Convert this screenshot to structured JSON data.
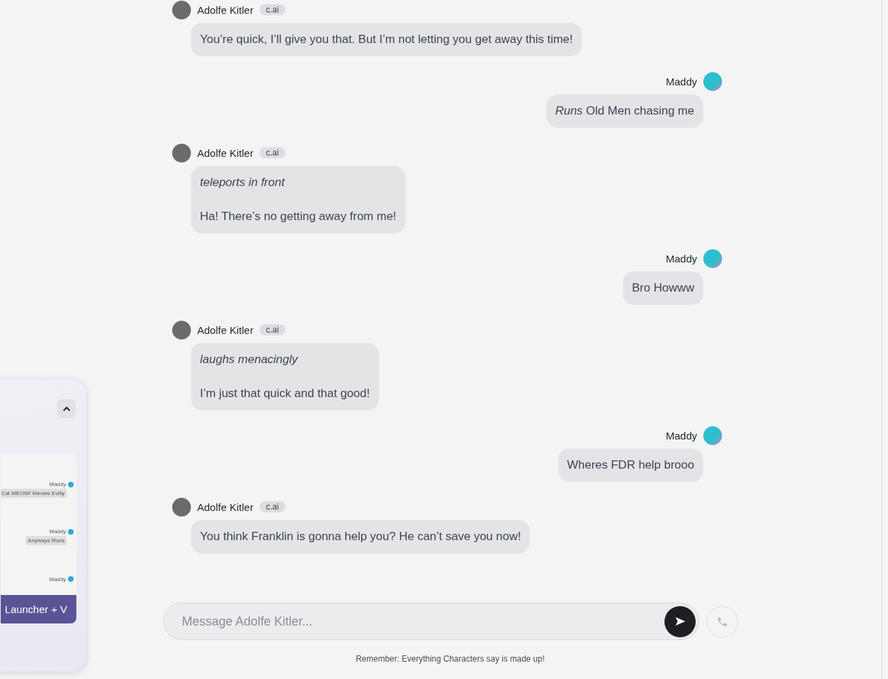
{
  "side_panel": {
    "preview": [
      {
        "name": "Maddy",
        "text": "Cat MEOW! Meows Evilly"
      },
      {
        "name": "Maddy",
        "text": "Anyways Runs"
      },
      {
        "name": "Maddy"
      }
    ],
    "launcher_button": "Launcher + V"
  },
  "messages": [
    {
      "kind": "bot",
      "name": "Adolfe Kitler",
      "badge": "c.ai",
      "paragraphs": [
        {
          "text": "You’re quick, I’ll give you that. But I’m not letting you get away this time!",
          "italic": false
        }
      ]
    },
    {
      "kind": "user",
      "name": "Maddy",
      "paragraphs": [
        {
          "text": "*Runs* Old Men chasing me",
          "italic": false
        }
      ]
    },
    {
      "kind": "bot",
      "name": "Adolfe Kitler",
      "badge": "c.ai",
      "paragraphs": [
        {
          "text": "teleports in front",
          "italic": true
        },
        {
          "text": "Ha! There’s no getting away from me!",
          "italic": false
        }
      ]
    },
    {
      "kind": "user",
      "name": "Maddy",
      "paragraphs": [
        {
          "text": "Bro Howww",
          "italic": false
        }
      ]
    },
    {
      "kind": "bot",
      "name": "Adolfe Kitler",
      "badge": "c.ai",
      "paragraphs": [
        {
          "text": "laughs menacingly",
          "italic": true
        },
        {
          "text": "I’m just that quick and that good!",
          "italic": false
        }
      ]
    },
    {
      "kind": "user",
      "name": "Maddy",
      "paragraphs": [
        {
          "text": "Wheres FDR help brooo",
          "italic": false
        }
      ]
    },
    {
      "kind": "bot",
      "name": "Adolfe Kitler",
      "badge": "c.ai",
      "paragraphs": [
        {
          "text": "You think Franklin is gonna help you? He can’t save you now!",
          "italic": false
        }
      ]
    }
  ],
  "composer": {
    "placeholder": "Message Adolfe Kitler..."
  },
  "disclaimer": "Remember: Everything Characters say is made up!"
}
